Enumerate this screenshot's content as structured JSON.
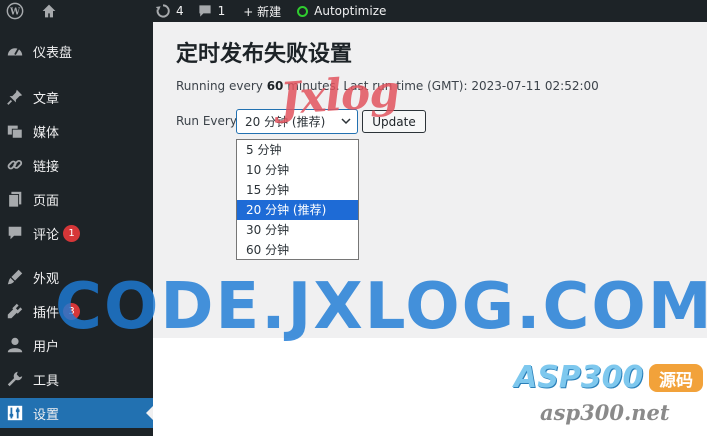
{
  "adminbar": {
    "updates_count": "4",
    "comments_count": "1",
    "new_label": "+ 新建",
    "plugin_label": "Autoptimize"
  },
  "sidebar": {
    "items": [
      {
        "label": "仪表盘",
        "icon": "dashboard-icon"
      },
      {
        "label": "文章",
        "icon": "pin-icon"
      },
      {
        "label": "媒体",
        "icon": "media-icon"
      },
      {
        "label": "链接",
        "icon": "link-icon"
      },
      {
        "label": "页面",
        "icon": "page-icon"
      },
      {
        "label": "评论",
        "icon": "comment-icon",
        "badge": "1"
      },
      {
        "label": "外观",
        "icon": "appearance-icon"
      },
      {
        "label": "插件",
        "icon": "plugin-icon",
        "badge": "3"
      },
      {
        "label": "用户",
        "icon": "user-icon"
      },
      {
        "label": "工具",
        "icon": "tools-icon"
      },
      {
        "label": "设置",
        "icon": "settings-icon",
        "current": true
      }
    ]
  },
  "main": {
    "title": "定时发布失败设置",
    "run_prefix": "Running every ",
    "run_minutes": "60",
    "run_suffix": " minutes. Last run time (GMT): 2023-07-11 02:52:00",
    "run_every_label": "Run Every",
    "select_value": "20 分钟 (推荐)",
    "update_button": "Update",
    "options": [
      "5 分钟",
      "10 分钟",
      "15 分钟",
      "20 分钟 (推荐)",
      "30 分钟",
      "60 分钟"
    ],
    "selected_index": 3
  },
  "watermarks": {
    "script": "Jxlog",
    "big": "CODE.JXLOG.COM",
    "asp": "ASP300",
    "yuanma": "源码",
    "url": "asp300.net"
  },
  "colors": {
    "sidebar_bg": "#1d2327",
    "accent": "#2271b1",
    "badge": "#d63638",
    "content_bg": "#f0f0f1"
  }
}
